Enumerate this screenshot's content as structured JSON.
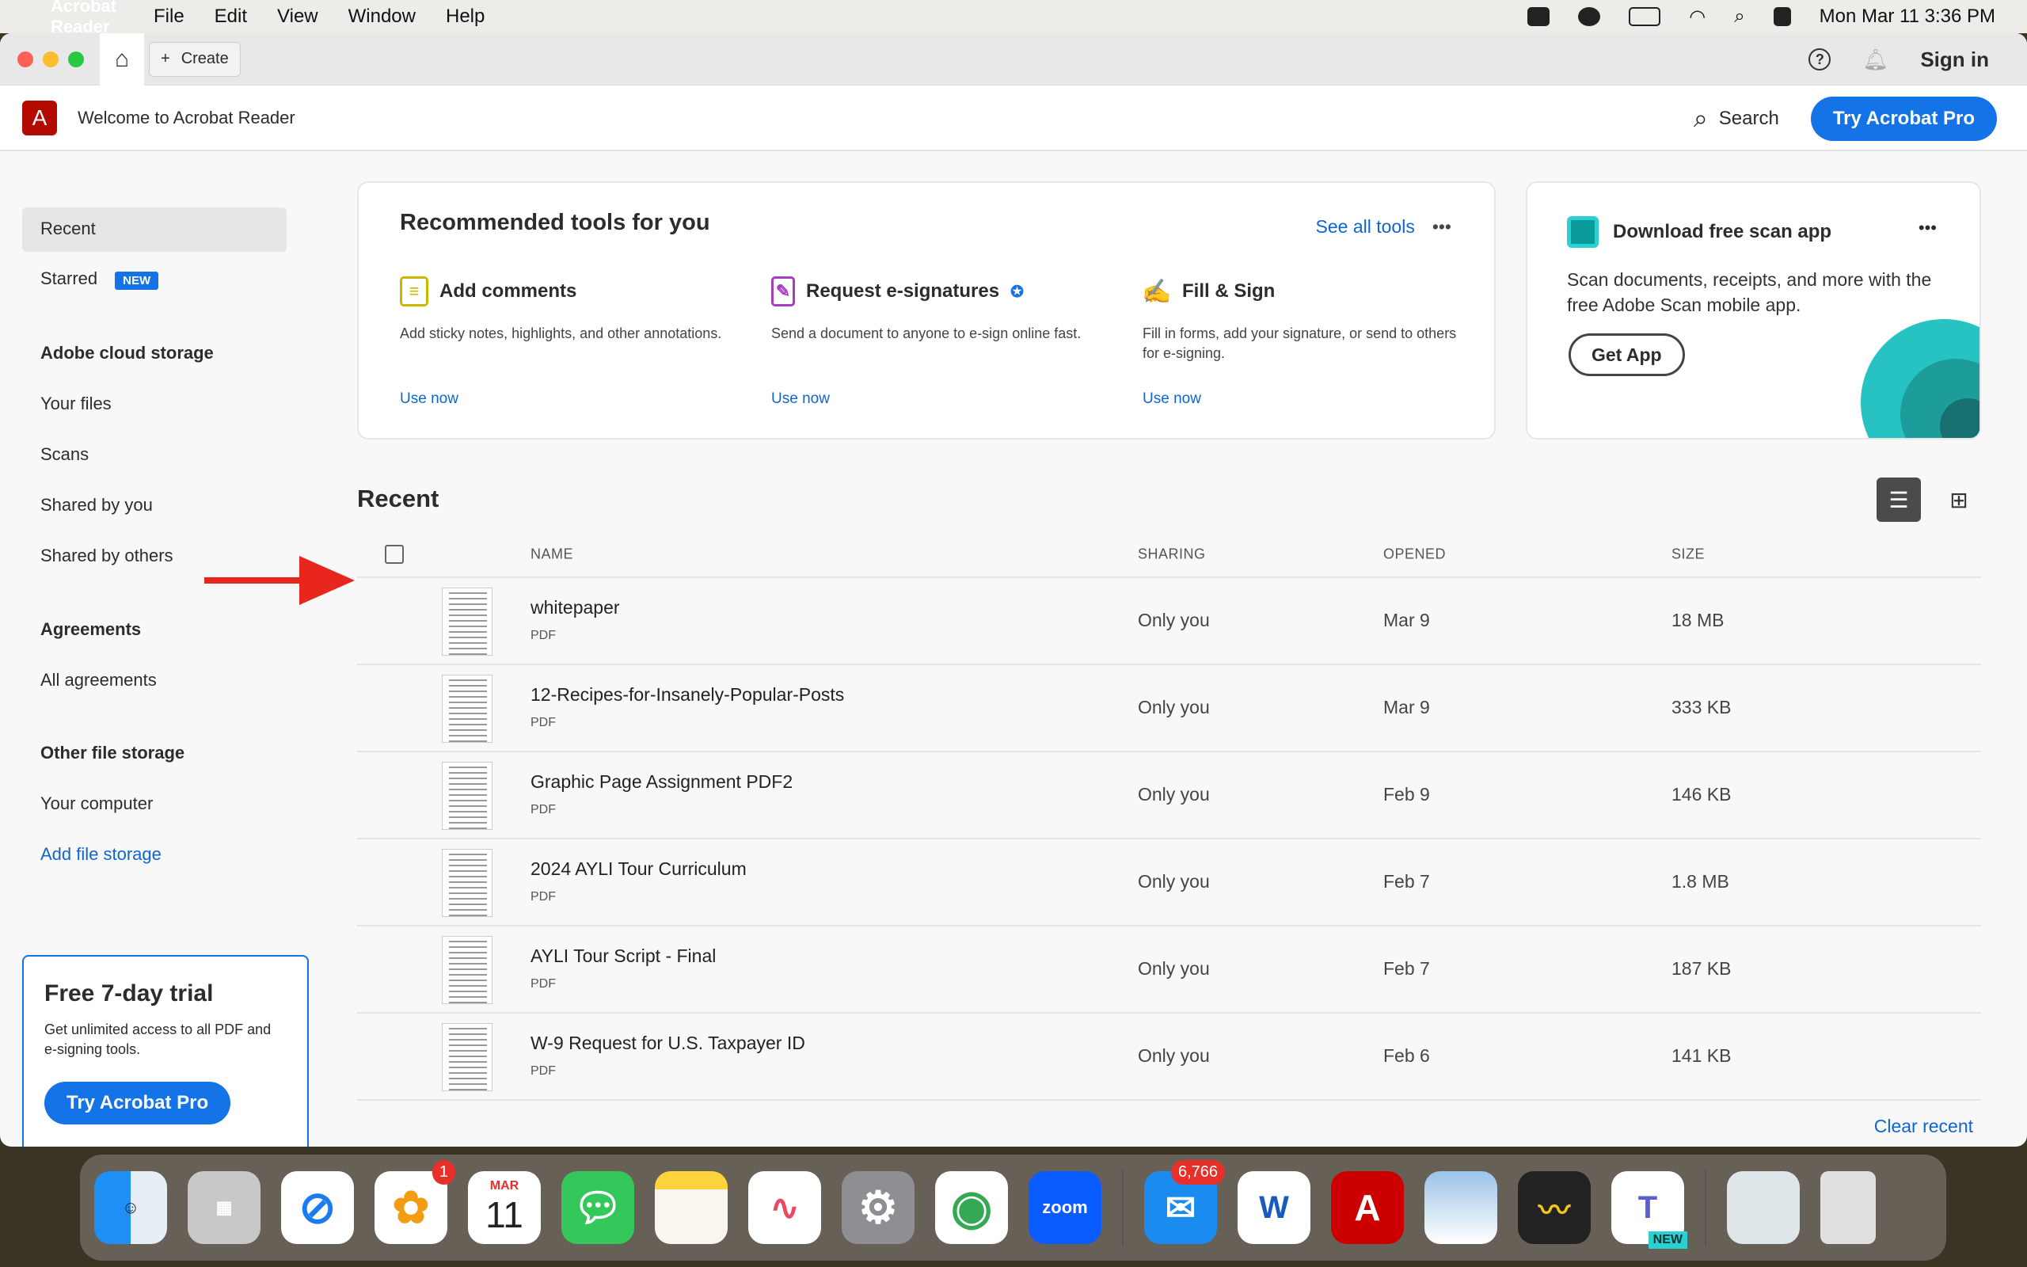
{
  "menubar": {
    "app": "Acrobat Reader",
    "items": [
      "File",
      "Edit",
      "View",
      "Window",
      "Help"
    ],
    "clock": "Mon Mar 11  3:36 PM"
  },
  "titlebar": {
    "create": "Create",
    "sign_in": "Sign in"
  },
  "header": {
    "title": "Welcome to Acrobat Reader",
    "search": "Search",
    "try_pro": "Try Acrobat Pro"
  },
  "sidebar": {
    "recent": "Recent",
    "starred": "Starred",
    "new_badge": "NEW",
    "cloud_head": "Adobe cloud storage",
    "your_files": "Your files",
    "scans": "Scans",
    "shared_by_you": "Shared by you",
    "shared_by_others": "Shared by others",
    "agreements_head": "Agreements",
    "all_agreements": "All agreements",
    "other_head": "Other file storage",
    "your_computer": "Your computer",
    "add_storage": "Add file storage"
  },
  "trial": {
    "title": "Free 7-day trial",
    "text": "Get unlimited access to all PDF and e-signing tools.",
    "button": "Try Acrobat Pro"
  },
  "recommended": {
    "title": "Recommended tools for you",
    "see_all": "See all tools",
    "more": "•••",
    "tools": [
      {
        "name": "Add comments",
        "desc": "Add sticky notes, highlights, and other annotations.",
        "use": "Use now"
      },
      {
        "name": "Request e-signatures",
        "desc": "Send a document to anyone to e-sign online fast.",
        "use": "Use now"
      },
      {
        "name": "Fill & Sign",
        "desc": "Fill in forms, add your signature, or send to others for e-signing.",
        "use": "Use now"
      }
    ]
  },
  "scan": {
    "title": "Download free scan app",
    "more": "•••",
    "text": "Scan documents, receipts, and more with the free Adobe Scan mobile app.",
    "button": "Get App"
  },
  "recent": {
    "title": "Recent",
    "columns": {
      "name": "NAME",
      "sharing": "SHARING",
      "opened": "OPENED",
      "size": "SIZE"
    },
    "files": [
      {
        "name": "whitepaper",
        "type": "PDF",
        "sharing": "Only you",
        "opened": "Mar 9",
        "size": "18 MB"
      },
      {
        "name": "12-Recipes-for-Insanely-Popular-Posts",
        "type": "PDF",
        "sharing": "Only you",
        "opened": "Mar 9",
        "size": "333 KB"
      },
      {
        "name": "Graphic Page Assignment PDF2",
        "type": "PDF",
        "sharing": "Only you",
        "opened": "Feb 9",
        "size": "146 KB"
      },
      {
        "name": "2024 AYLI Tour Curriculum",
        "type": "PDF",
        "sharing": "Only you",
        "opened": "Feb 7",
        "size": "1.8 MB"
      },
      {
        "name": "AYLI Tour Script - Final",
        "type": "PDF",
        "sharing": "Only you",
        "opened": "Feb 7",
        "size": "187 KB"
      },
      {
        "name": "W-9 Request for U.S. Taxpayer ID",
        "type": "PDF",
        "sharing": "Only you",
        "opened": "Feb 6",
        "size": "141 KB"
      }
    ],
    "clear": "Clear recent"
  },
  "dock": {
    "photos_badge": "1",
    "calendar_month": "MAR",
    "calendar_day": "11",
    "zoom": "zoom",
    "mail_badge": "6,766",
    "teams_new": "NEW"
  }
}
